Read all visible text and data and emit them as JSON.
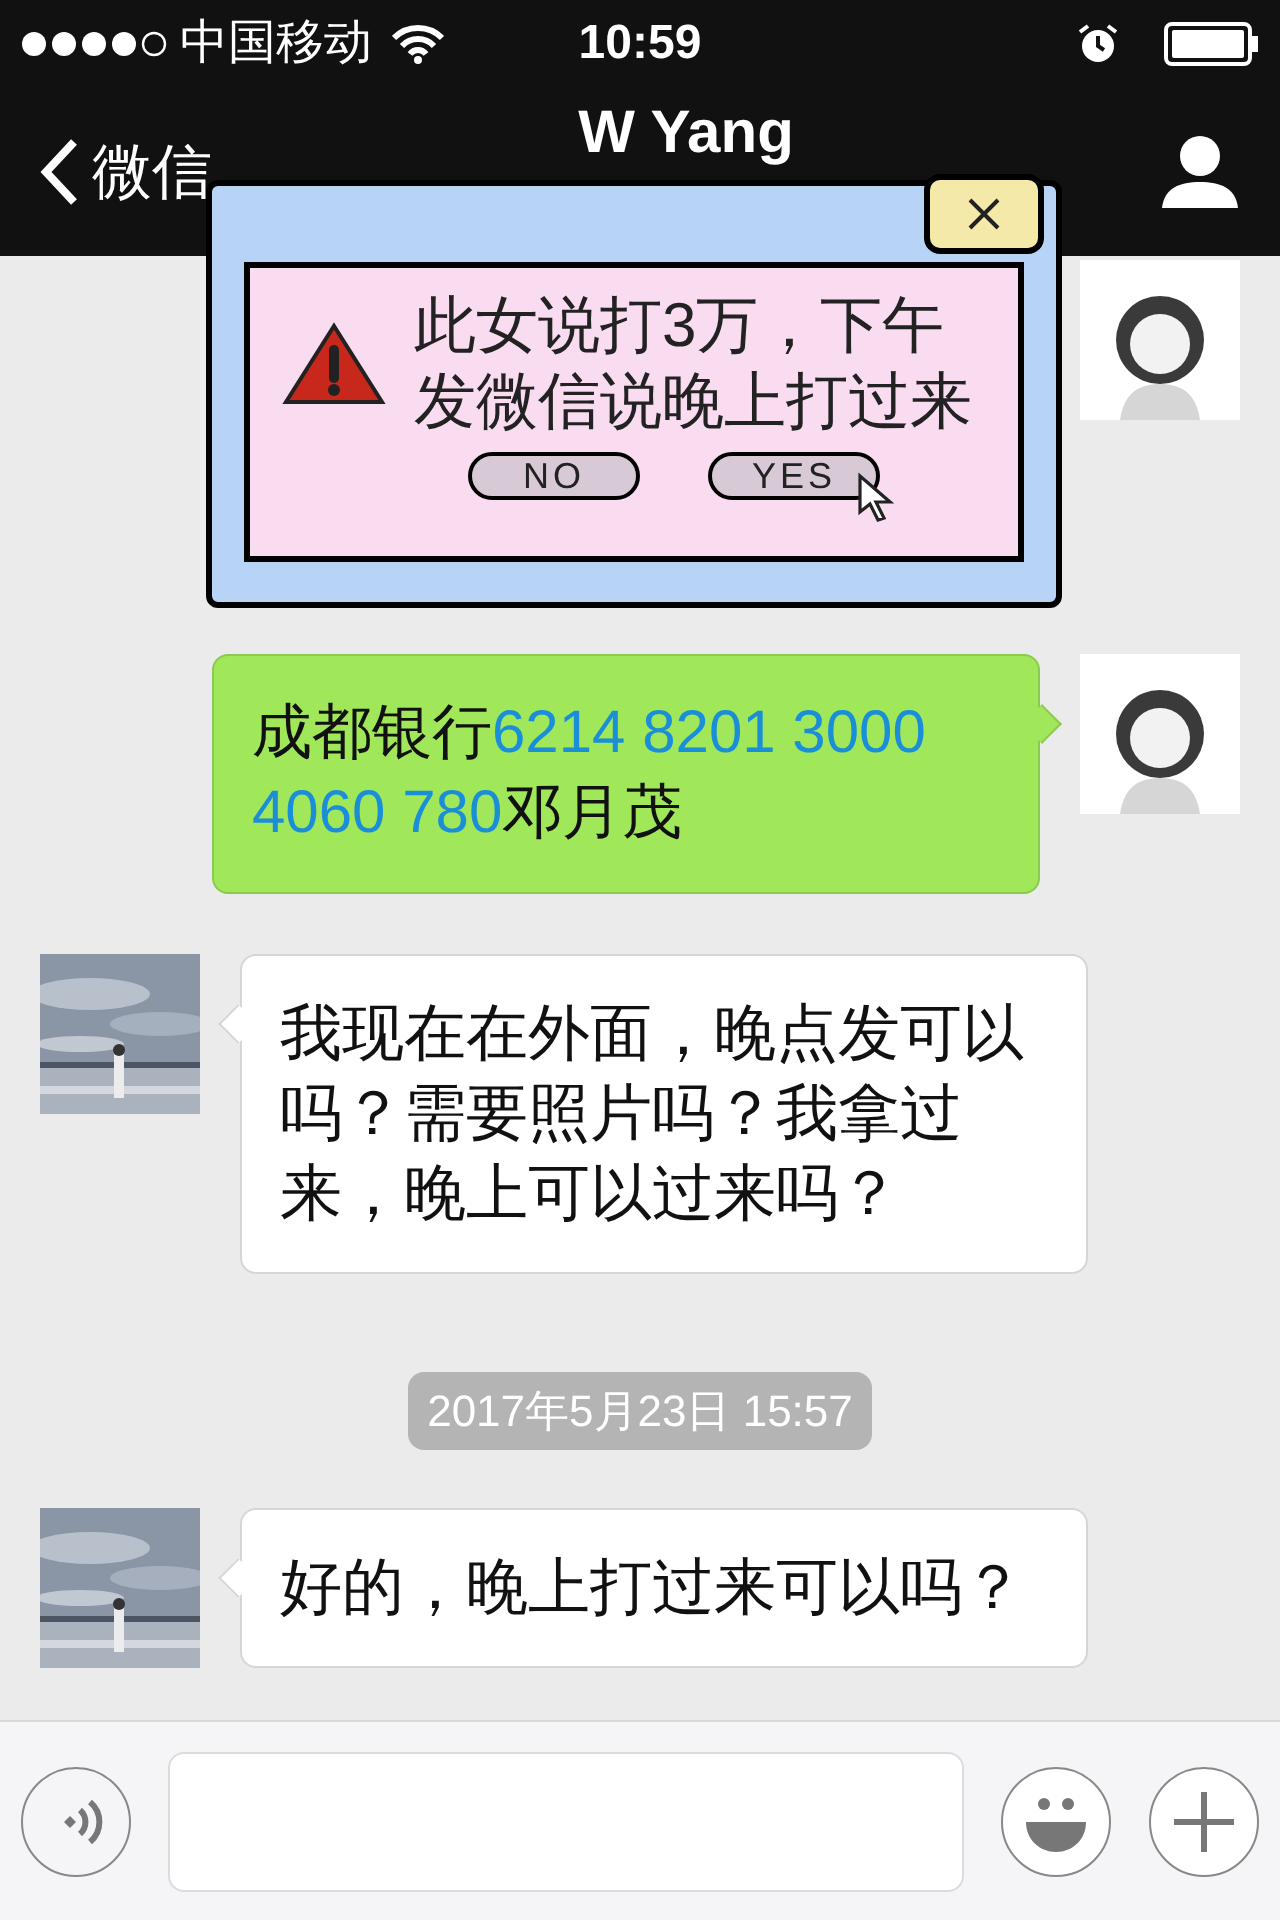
{
  "status_bar": {
    "carrier": "中国移动",
    "time": "10:59"
  },
  "nav": {
    "back_label": "微信",
    "title": "W Yang"
  },
  "messages": [
    {
      "kind": "message",
      "outgoing": true
    },
    {
      "kind": "message",
      "outgoing": true,
      "parts": [
        {
          "kind": "text",
          "text": "成都银行"
        },
        {
          "kind": "number",
          "text": "6214 8201 3000 4060 780"
        },
        {
          "kind": "text",
          "text": "邓月茂"
        }
      ]
    },
    {
      "kind": "message",
      "outgoing": false,
      "parts": [
        {
          "kind": "text",
          "text": "我现在在外面，晚点发可以吗？需要照片吗？我拿过来，晚上可以过来吗？"
        }
      ]
    },
    {
      "kind": "timestamp",
      "text": "2017年5月23日 15:57"
    },
    {
      "kind": "message",
      "outgoing": false,
      "parts": [
        {
          "kind": "text",
          "text": "好的，晚上打过来可以吗？"
        }
      ]
    }
  ],
  "overlay_dialog": {
    "message": "此女说打3万，下午发微信说晚上打过来",
    "buttons": [
      {
        "label": "NO",
        "pointed": false
      },
      {
        "label": "YES",
        "pointed": true
      }
    ]
  }
}
